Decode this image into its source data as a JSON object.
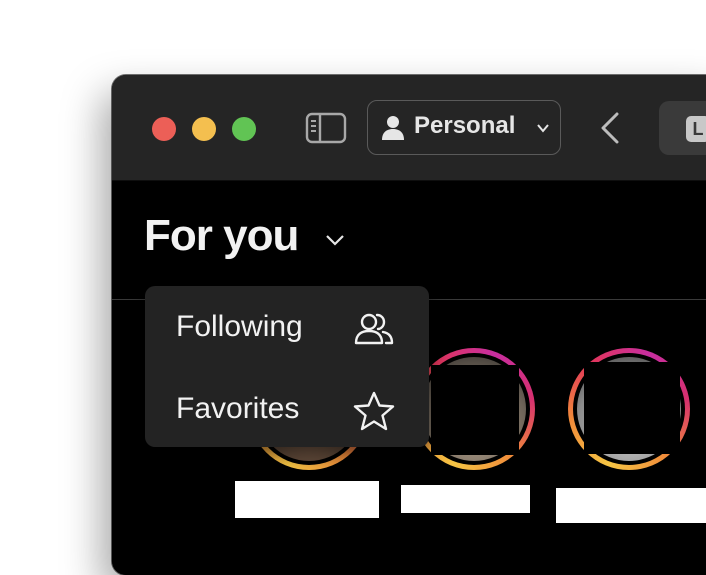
{
  "titlebar": {
    "profile_label": "Personal",
    "tab_badge": "L"
  },
  "feed": {
    "title": "For you"
  },
  "menu": {
    "items": [
      {
        "label": "Following",
        "icon": "people-icon"
      },
      {
        "label": "Favorites",
        "icon": "star-icon"
      }
    ]
  },
  "colors": {
    "close": "#ec5f57",
    "minimize": "#f4bf4f",
    "zoom": "#61c454",
    "titlebar": "#252525",
    "content_bg": "#000000",
    "menu_bg": "#232323"
  }
}
